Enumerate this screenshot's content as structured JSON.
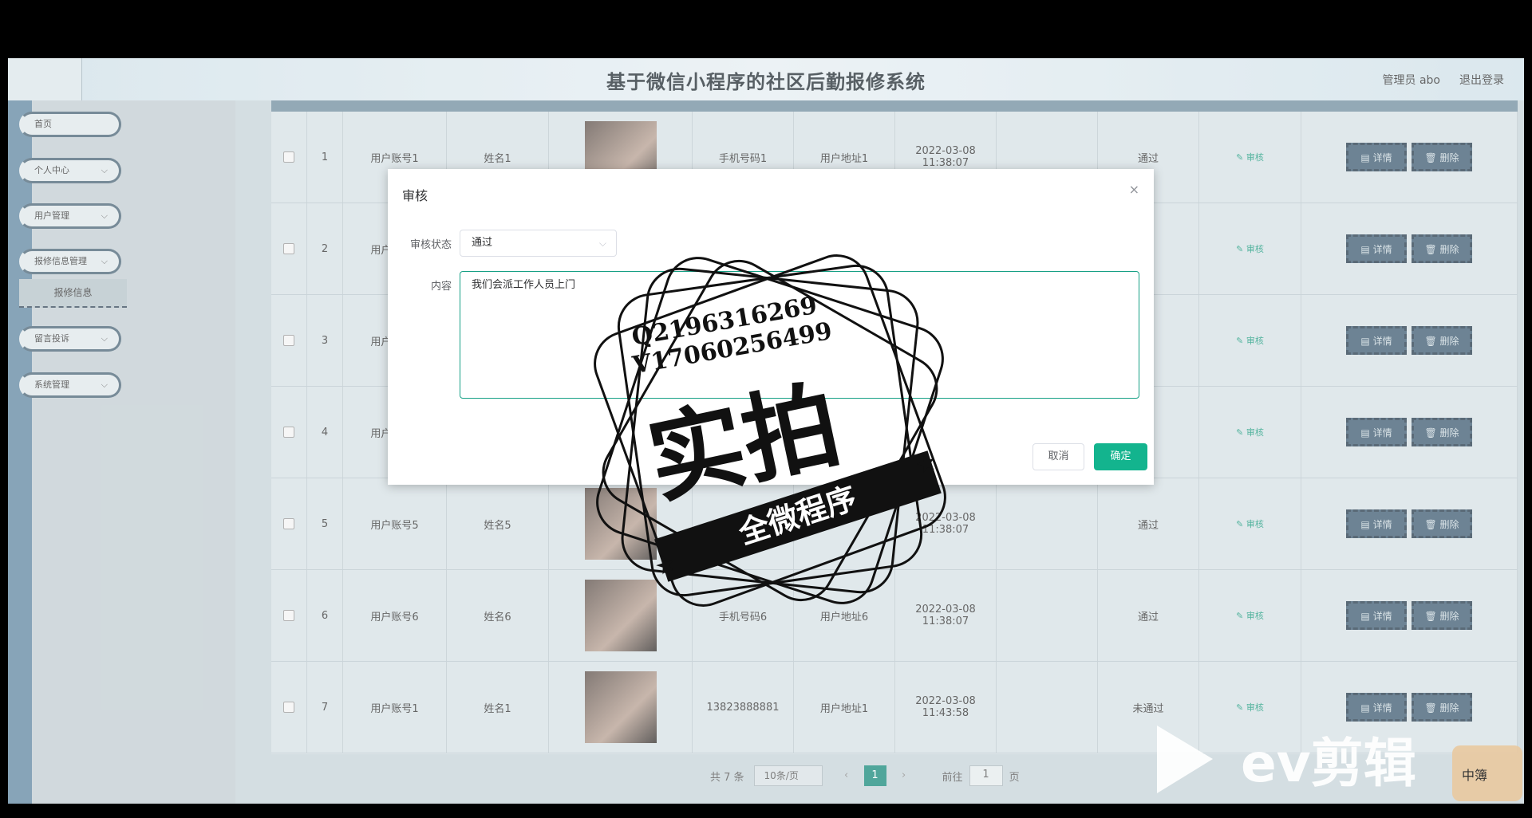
{
  "header": {
    "title": "基于微信小程序的社区后勤报修系统",
    "user": "管理员 abo",
    "logout": "退出登录"
  },
  "sidebar": {
    "items": [
      {
        "label": "首页",
        "has_children": false
      },
      {
        "label": "个人中心",
        "has_children": true
      },
      {
        "label": "用户管理",
        "has_children": true
      },
      {
        "label": "报修信息管理",
        "has_children": true
      },
      {
        "label": "留言投诉",
        "has_children": true
      },
      {
        "label": "系统管理",
        "has_children": true
      }
    ],
    "sub_item": "报修信息"
  },
  "table": {
    "audit_label": "审核",
    "detail_label": "详情",
    "delete_label": "删除",
    "rows": [
      {
        "index": "1",
        "account": "用户账号1",
        "name": "姓名1",
        "phone": "手机号码1",
        "address": "用户地址1",
        "time": "2022-03-08 11:38:07",
        "status": "通过"
      },
      {
        "index": "2",
        "account": "用户账号2",
        "name": "",
        "phone": "",
        "address": "",
        "time": "",
        "status": ""
      },
      {
        "index": "3",
        "account": "用户账号3",
        "name": "",
        "phone": "",
        "address": "",
        "time": "",
        "status": ""
      },
      {
        "index": "4",
        "account": "用户账号4",
        "name": "",
        "phone": "",
        "address": "",
        "time": "",
        "status": ""
      },
      {
        "index": "5",
        "account": "用户账号5",
        "name": "姓名5",
        "phone": "",
        "address": "",
        "time": "2022-03-08 11:38:07",
        "status": "通过"
      },
      {
        "index": "6",
        "account": "用户账号6",
        "name": "姓名6",
        "phone": "手机号码6",
        "address": "用户地址6",
        "time": "2022-03-08 11:38:07",
        "status": "通过"
      },
      {
        "index": "7",
        "account": "用户账号1",
        "name": "姓名1",
        "phone": "13823888881",
        "address": "用户地址1",
        "time": "2022-03-08 11:43:58",
        "status": "未通过"
      }
    ]
  },
  "pager": {
    "total": "共 7 条",
    "page_size": "10条/页",
    "prev": "‹",
    "current": "1",
    "next": "›",
    "goto_prefix": "前往",
    "goto_value": "1",
    "goto_suffix": "页"
  },
  "dialog": {
    "title": "审核",
    "close": "×",
    "status_label": "审核状态",
    "status_value": "通过",
    "content_label": "内容",
    "content_value": "我们会派工作人员上门",
    "cancel": "取消",
    "confirm": "确定"
  },
  "watermark": {
    "contact_q": "Q2196316269",
    "contact_v": "V17060256499",
    "main": "实拍",
    "banner": "全微程序",
    "ev_brand": "ev剪辑",
    "ev_small": "中簿"
  },
  "colors": {
    "accent": "#13b48e",
    "page_current": "#16897a",
    "op_button": "#3c5a70"
  }
}
